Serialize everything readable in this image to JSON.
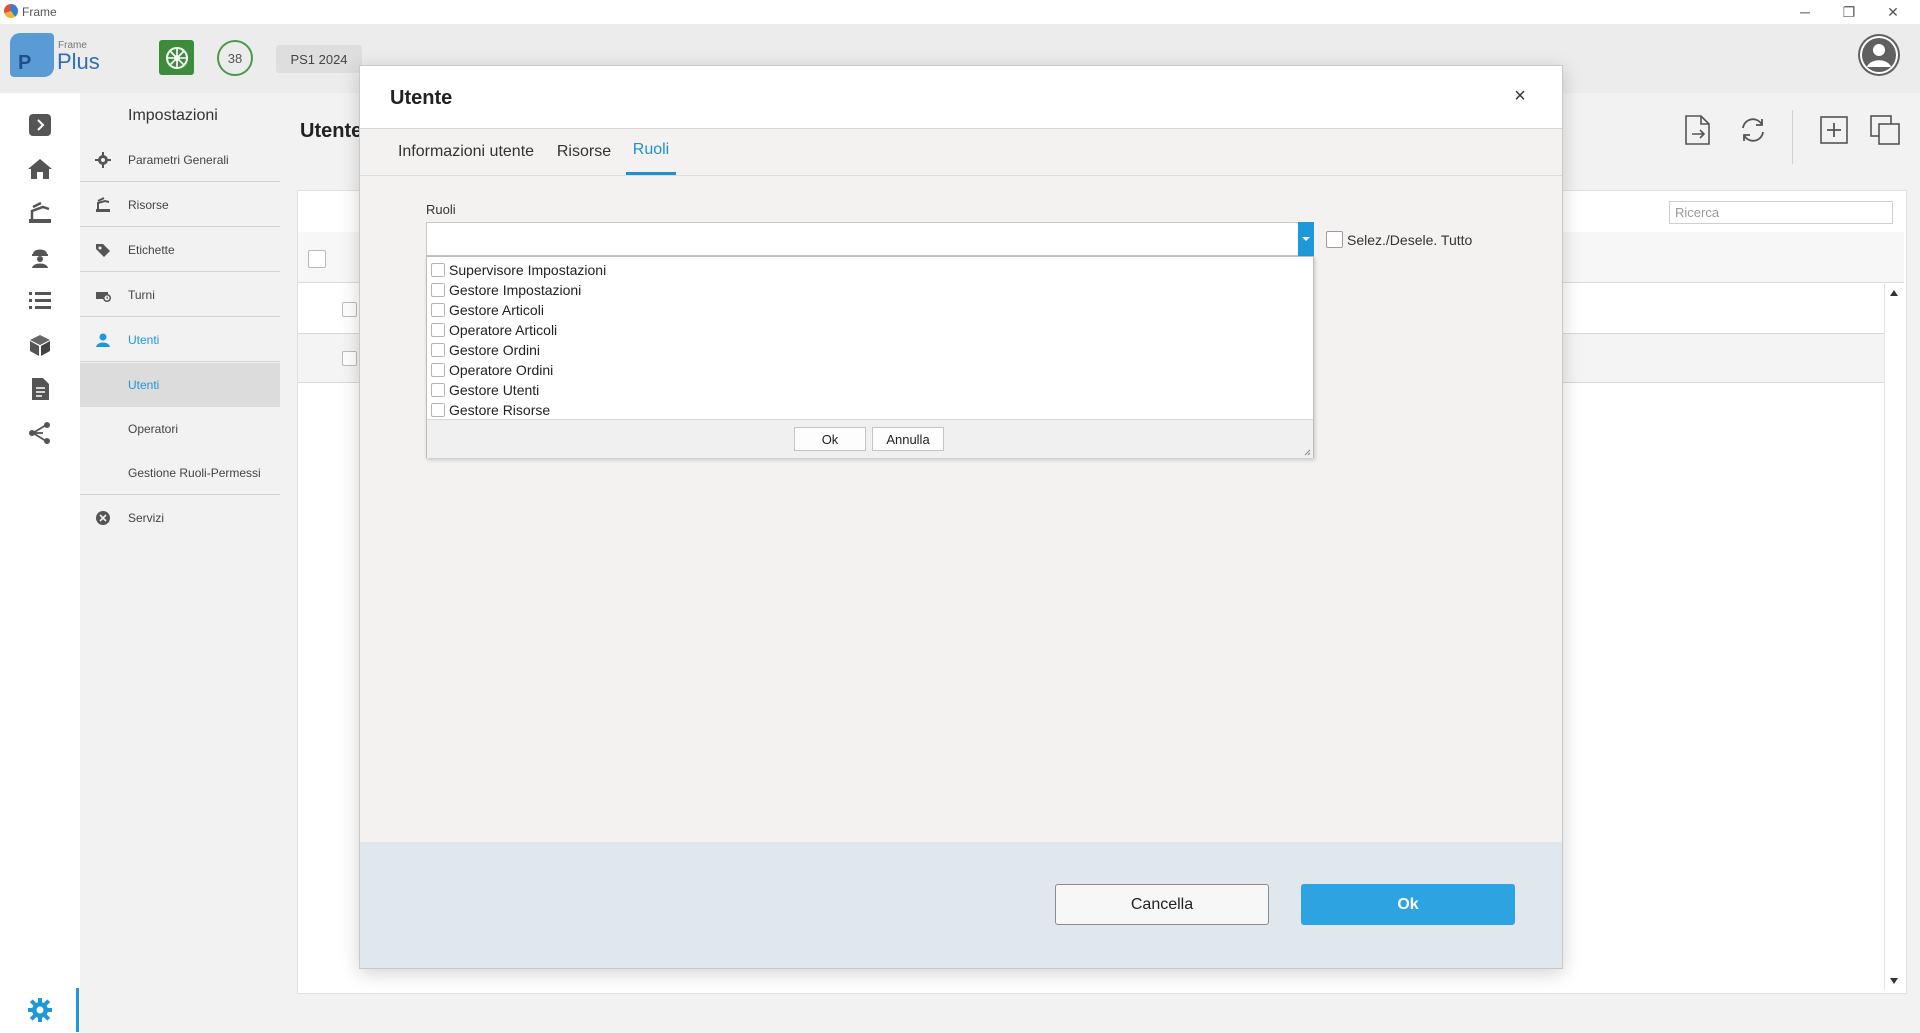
{
  "window": {
    "title": "Frame",
    "minimize": "─",
    "restore": "❐",
    "close": "✕"
  },
  "header": {
    "logo_small": "Frame",
    "logo_big": "Plus",
    "logo_letter": "P",
    "count_badge": "38",
    "period": "PS1 2024"
  },
  "colors": {
    "accent": "#1f98d9",
    "ok_button": "#2ea3e1",
    "plant_badge": "#3c8c3c",
    "footer": "#e0e8ee"
  },
  "rail_icons": [
    "expand-icon",
    "home-icon",
    "machine-icon",
    "operator-icon",
    "list-icon",
    "box-icon",
    "document-icon",
    "share-icon",
    "settings-icon"
  ],
  "settings_panel": {
    "title": "Impostazioni",
    "items": [
      {
        "label": "Parametri Generali",
        "icon": "gear-icon"
      },
      {
        "label": "Risorse",
        "icon": "machine-icon"
      },
      {
        "label": "Etichette",
        "icon": "tag-icon"
      },
      {
        "label": "Turni",
        "icon": "shift-icon"
      },
      {
        "label": "Utenti",
        "icon": "user-icon"
      },
      {
        "label": "Servizi",
        "icon": "close-circle-icon"
      }
    ],
    "subitems": [
      {
        "label": "Utenti"
      },
      {
        "label": "Operatori"
      },
      {
        "label": "Gestione Ruoli-Permessi"
      }
    ]
  },
  "main": {
    "title": "Utente",
    "search_placeholder": "Ricerca"
  },
  "modal": {
    "title": "Utente",
    "close": "×",
    "tabs": [
      {
        "label": "Informazioni utente"
      },
      {
        "label": "Risorse"
      },
      {
        "label": "Ruoli"
      }
    ],
    "field_label": "Ruoli",
    "select_all_label": "Selez./Desele. Tutto",
    "options": [
      {
        "label": "Supervisore Impostazioni"
      },
      {
        "label": "Gestore Impostazioni"
      },
      {
        "label": "Gestore Articoli"
      },
      {
        "label": "Operatore Articoli"
      },
      {
        "label": "Gestore Ordini"
      },
      {
        "label": "Operatore Ordini"
      },
      {
        "label": "Gestore Utenti"
      },
      {
        "label": "Gestore Risorse"
      }
    ],
    "dropdown_ok": "Ok",
    "dropdown_cancel": "Annulla",
    "cancel_label": "Cancella",
    "ok_label": "Ok"
  }
}
